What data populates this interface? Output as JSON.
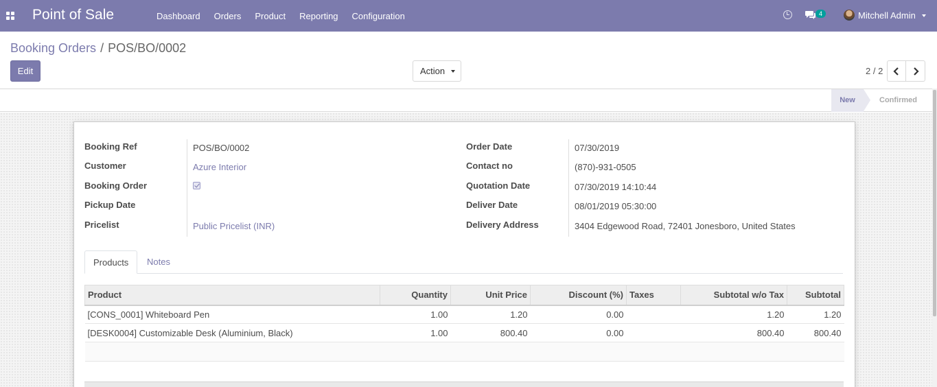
{
  "navbar": {
    "brand": "Point of Sale",
    "menu": [
      "Dashboard",
      "Orders",
      "Product",
      "Reporting",
      "Configuration"
    ],
    "chat_count": "4",
    "user_name": "Mitchell Admin"
  },
  "breadcrumb": {
    "parent": "Booking Orders",
    "separator": "/",
    "current": "POS/BO/0002"
  },
  "buttons": {
    "edit": "Edit",
    "action": "Action"
  },
  "pager": {
    "value": "2 / 2"
  },
  "status": {
    "new": "New",
    "confirmed": "Confirmed"
  },
  "form": {
    "left": [
      {
        "label": "Booking Ref",
        "value": "POS/BO/0002",
        "link": false
      },
      {
        "label": "Customer",
        "value": "Azure Interior",
        "link": true
      },
      {
        "label": "Booking Order",
        "value": "",
        "checkbox": true
      },
      {
        "label": "Pickup Date",
        "value": ""
      },
      {
        "label": "Pricelist",
        "value": "Public Pricelist (INR)",
        "link": true
      }
    ],
    "right": [
      {
        "label": "Order Date",
        "value": "07/30/2019"
      },
      {
        "label": "Contact no",
        "value": "(870)-931-0505"
      },
      {
        "label": "Quotation Date",
        "value": "07/30/2019 14:10:44"
      },
      {
        "label": "Deliver Date",
        "value": "08/01/2019 05:30:00"
      },
      {
        "label": "Delivery Address",
        "value": "3404 Edgewood Road, 72401 Jonesboro, United States"
      }
    ]
  },
  "tabs": [
    "Products",
    "Notes"
  ],
  "table": {
    "headers": [
      "Product",
      "Quantity",
      "Unit Price",
      "Discount (%)",
      "Taxes",
      "Subtotal w/o Tax",
      "Subtotal"
    ],
    "rows": [
      [
        "[CONS_0001] Whiteboard Pen",
        "1.00",
        "1.20",
        "0.00",
        "",
        "1.20",
        "1.20"
      ],
      [
        "[DESK0004] Customizable Desk (Aluminium, Black)",
        "1.00",
        "800.40",
        "0.00",
        "",
        "800.40",
        "800.40"
      ]
    ]
  },
  "colors": {
    "brand": "#7c7bad",
    "badge": "#00a09d"
  }
}
